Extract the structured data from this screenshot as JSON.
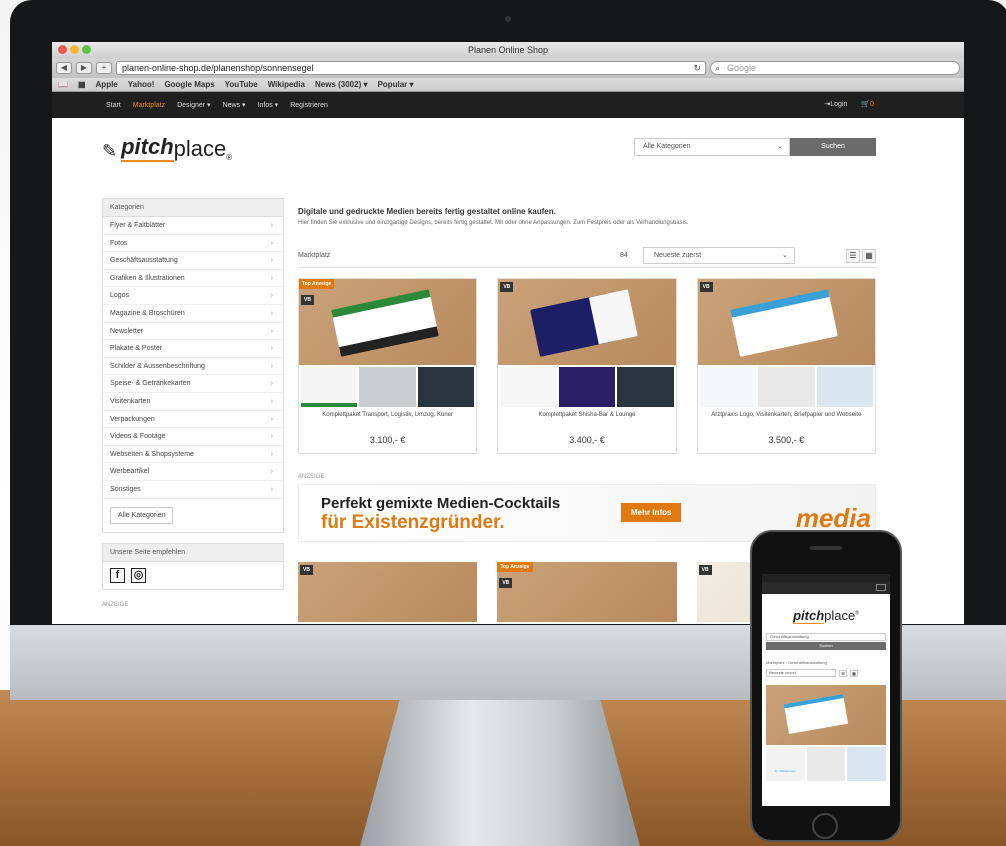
{
  "browser": {
    "window_title": "Planen Online Shop",
    "url": "planen-online-shop.de/planenshop/sonnensegel",
    "search_placeholder": "Google",
    "bookmarks": [
      "Apple",
      "Yahoo!",
      "Google Maps",
      "YouTube",
      "Wikipedia",
      "News (3002) ▾",
      "Popular ▾"
    ]
  },
  "site_nav": {
    "items": [
      "Start",
      "Marktplatz",
      "Designer ▾",
      "News ▾",
      "Infos ▾",
      "Registrieren"
    ],
    "login": "Login",
    "cart": "0"
  },
  "header": {
    "logo_prefix": "pitch",
    "logo_suffix": "place",
    "logo_reg": "®",
    "category_select": "Alle Kategorien",
    "search_button": "Suchen"
  },
  "sidebar": {
    "heading": "Kategorien",
    "items": [
      "Flyer & Faltblätter",
      "Fotos",
      "Geschäftsausstattung",
      "Grafiken & Illustrationen",
      "Logos",
      "Magazine & Broschüren",
      "Newsletter",
      "Plakate & Poster",
      "Schilder & Aussenbeschriftung",
      "Speise- & Getränkekarten",
      "Visitenkarten",
      "Verpackungen",
      "Videos & Footage",
      "Webseiten & Shopsysteme",
      "Werbeartikel",
      "Sonstiges"
    ],
    "all_button": "Alle Kategorien",
    "share_heading": "Unsere Seite empfehlen",
    "ad_label": "ANZEIGE"
  },
  "main": {
    "headline": "Digitale und gedruckte Medien bereits fertig gestaltet online kaufen.",
    "subline": "Hier finden Sie exklusive und einzigartige Designs, bereits fertig gestaltet. Mit oder ohne Anpassungen. Zum Festpreis oder als Verhandlungsbasis.",
    "breadcrumb": "Marktplatz",
    "count": "84",
    "sort": "Neueste zuerst",
    "cards": [
      {
        "badge_top": "Top Anzeige",
        "badge": "VB",
        "title": "Komplettpaket Transport, Logistik, Umzug, Kurier",
        "price": "3.100,- €",
        "accent": "#2a8a3a"
      },
      {
        "badge_top": "",
        "badge": "VB",
        "title": "Komplettpaket Shisha-Bar & Lounge",
        "price": "3.400,- €",
        "accent": "#2a2f8a"
      },
      {
        "badge_top": "",
        "badge": "VB",
        "title": "Arztpraxis Logo, Visitenkarten, Briefpapier und Webseite",
        "price": "3.500,- €",
        "accent": "#3aa0d8"
      }
    ],
    "ad_label": "ANZEIGE",
    "banner": {
      "line1": "Perfekt gemixte Medien-Cocktails",
      "line2": "für Existenzgründer.",
      "button": "Mehr Infos",
      "brand": "media"
    },
    "row2_badges": [
      {
        "badge_top": "",
        "badge": "VB"
      },
      {
        "badge_top": "Top Anzeige",
        "badge": "VB"
      },
      {
        "badge_top": "",
        "badge": "VB"
      }
    ]
  },
  "phone": {
    "category_select": "Geschäftsausstattung",
    "search_button": "Suchen",
    "breadcrumb": "Marktplatz › Geschäftsausstattung",
    "sort": "Neueste zuerst",
    "card_name": "Dr. Mustermann"
  },
  "colors": {
    "accent": "#e07a10",
    "nav_bg": "#1f1f1f"
  }
}
